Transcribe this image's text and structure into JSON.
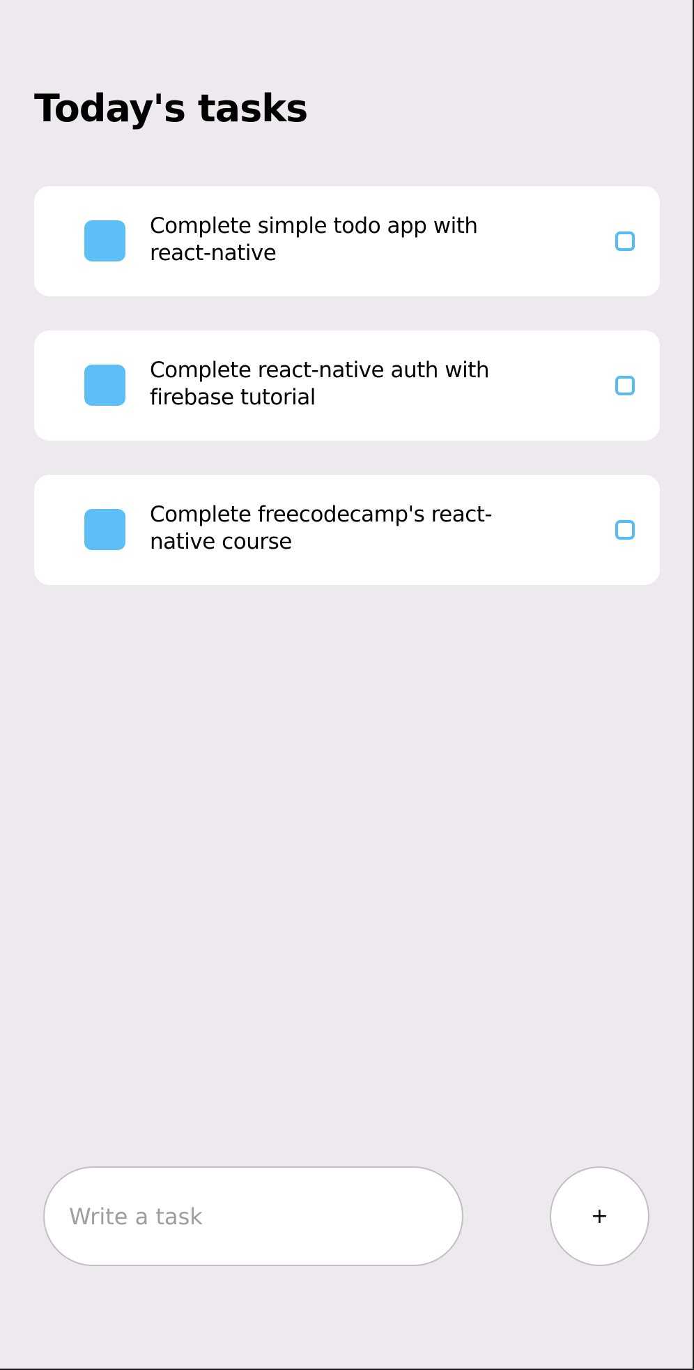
{
  "header": {
    "title": "Today's tasks"
  },
  "tasks": [
    {
      "text": "Complete simple todo app with react-native"
    },
    {
      "text": "Complete react-native auth with firebase tutorial"
    },
    {
      "text": "Complete freecodecamp's react-native course"
    }
  ],
  "input": {
    "placeholder": "Write a task",
    "value": ""
  },
  "add_button": {
    "label": "+"
  },
  "colors": {
    "background": "#ede9ee",
    "card": "#ffffff",
    "accent": "#55bcf6"
  }
}
